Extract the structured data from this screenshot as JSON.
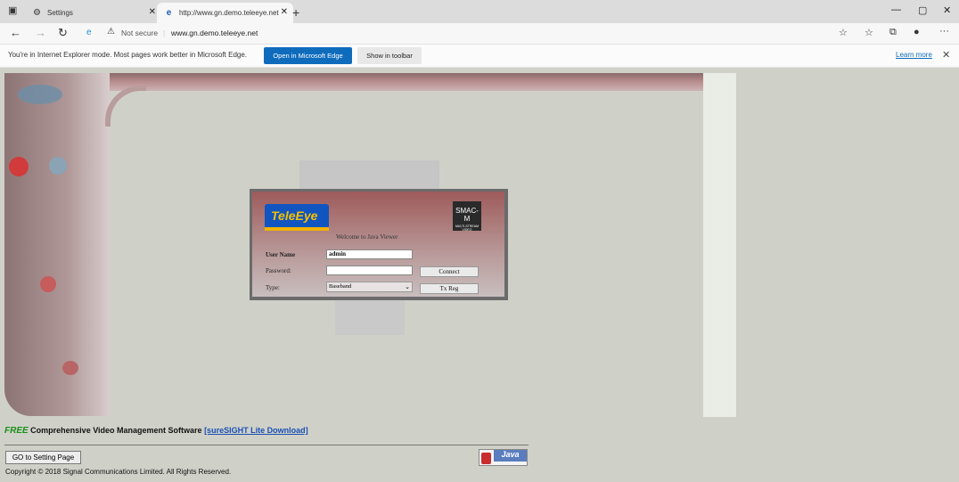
{
  "browser": {
    "tabs": [
      {
        "label": "Settings",
        "icon": "gear-icon"
      },
      {
        "label": "http://www.gn.demo.teleeye.net",
        "icon": "ie-icon"
      }
    ],
    "new_tab": "+",
    "window_controls": {
      "minimize": "—",
      "maximize": "▢",
      "close": "✕"
    },
    "address": {
      "security_label": "Not secure",
      "url": "www.gn.demo.teleeye.net"
    }
  },
  "infobar": {
    "message": "You're in Internet Explorer mode. Most pages work better in Microsoft Edge.",
    "open_button": "Open in Microsoft Edge",
    "show_button": "Show in toolbar",
    "learn_more": "Learn more"
  },
  "login": {
    "logo_text": "TeleEye",
    "badge_text": "SMAC-M",
    "badge_subtext": "MULTI-STREAM VIDEO",
    "welcome": "Welcome to Java Viewer",
    "username_label": "User Name",
    "username_value": "admin",
    "password_label": "Password:",
    "password_value": "",
    "type_label": "Type:",
    "type_value": "Baseband",
    "connect_button": "Connect",
    "txreg_button": "Tx Reg"
  },
  "footer": {
    "free_label": "FREE",
    "free_text": " Comprehensive Video Management Software ",
    "free_link": "[sureSIGHT Lite Download]",
    "setting_button": "GO to Setting Page",
    "copyright": "Copyright © 2018 Signal Communications Limited. All Rights Reserved.",
    "java_badge": "Java"
  }
}
